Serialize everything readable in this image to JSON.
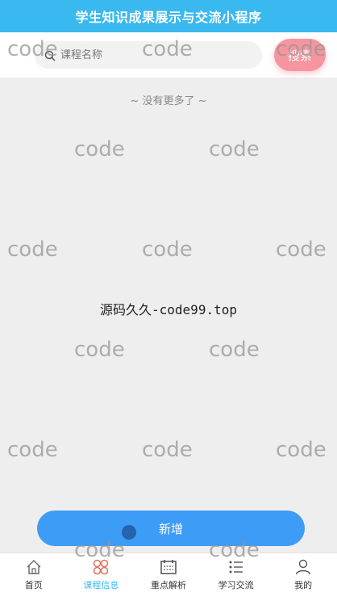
{
  "header": {
    "title": "学生知识成果展示与交流小程序"
  },
  "search": {
    "placeholder": "课程名称",
    "button_label": "搜索"
  },
  "list": {
    "empty_text": "~ 没有更多了 ~"
  },
  "watermark": {
    "center_text": "源码久久-code99.top",
    "tile_text": "code"
  },
  "actions": {
    "add_label": "新增"
  },
  "tabbar": {
    "items": [
      {
        "label": "首页",
        "icon": "home-icon",
        "active": false
      },
      {
        "label": "课程信息",
        "icon": "grid-icon",
        "active": true
      },
      {
        "label": "重点解析",
        "icon": "calendar-icon",
        "active": false
      },
      {
        "label": "学习交流",
        "icon": "list-icon",
        "active": false
      },
      {
        "label": "我的",
        "icon": "user-icon",
        "active": false
      }
    ]
  },
  "colors": {
    "header_bg": "#39b9f0",
    "search_button": "#f6959f",
    "add_button": "#3d9cf5",
    "active_tab": "#39b9f0"
  }
}
